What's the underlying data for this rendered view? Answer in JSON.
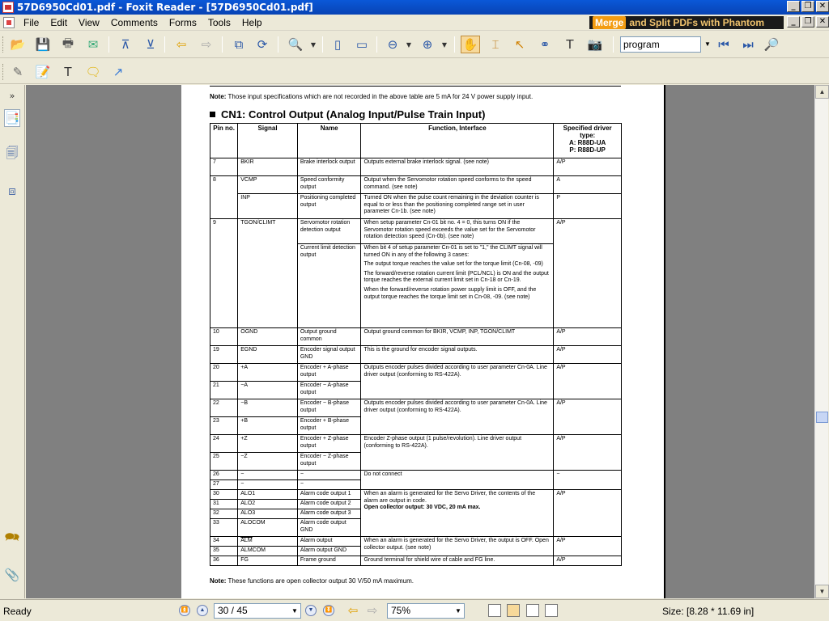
{
  "window": {
    "title": "57D6950Cd01.pdf - Foxit Reader - [57D6950Cd01.pdf]"
  },
  "menu": {
    "items": [
      "File",
      "Edit",
      "View",
      "Comments",
      "Forms",
      "Tools",
      "Help"
    ]
  },
  "promo": {
    "badge": "Merge",
    "text": "and Split PDFs with Phantom"
  },
  "toolbar": {
    "search_value": "program"
  },
  "document": {
    "note_top_label": "Note:",
    "note_top_text": "Those input specifications which are not recorded in the above table are 5 mA for 24 V power supply input.",
    "section_title": "CN1: Control Output (Analog Input/Pulse Train Input)",
    "table": {
      "headers": {
        "pin": "Pin no.",
        "signal": "Signal",
        "name": "Name",
        "function": "Function, Interface",
        "driver_title": "Specified driver type:",
        "driver_a": "A: R88D-UA",
        "driver_p": "P: R88D-UP"
      },
      "rows": [
        {
          "pin": "7",
          "signal": "BKIR",
          "name": "Brake interlock output",
          "function": "Outputs external brake interlock signal. (see note)",
          "driver": "A/P"
        },
        {
          "pin": "8",
          "signal": "VCMP",
          "name": "Speed conformity output",
          "function": "Output when the Servomotor rotation speed conforms to the speed command. (see note)",
          "driver": "A"
        },
        {
          "pin": "",
          "signal": "INP",
          "name": "Positioning completed output",
          "function": "Turned ON when the pulse count remaining in the deviation counter is equal to or less than the positioning completed range set in user parameter Cn-1b. (see note)",
          "driver": "P"
        },
        {
          "pin": "9",
          "signal": "TGON/CLIMT",
          "name": "Servomotor rotation detection output",
          "function": "When setup parameter Cn-01 bit no. 4 = 0, this turns ON if the Servomotor rotation speed exceeds the value set for the Servomotor rotation detection speed (Cn-0b). (see note)",
          "driver": "A/P"
        },
        {
          "pin": "",
          "signal": "",
          "name": "Current limit detection output",
          "function": "When bit 4 of setup parameter Cn-01 is set to \"1,\" the CLIMT signal will turned ON in any of the following 3 cases:",
          "function_2": "The output torque reaches the value set for the torque limit (Cn-08, -09)",
          "function_3": "The forward/reverse rotation current limit (PCL/NCL) is ON and the output torque reaches the external current limit set in Cn-18 or Cn-19.",
          "function_4": "When the forward/reverse rotation power supply limit is OFF, and the output torque reaches the torque limit set in Cn-08, -09. (see note)",
          "driver": ""
        },
        {
          "pin": "10",
          "signal": "OGND",
          "name": "Output ground common",
          "function": "Output ground common for BKIR, VCMP, INP, TGON/CLIMT",
          "driver": "A/P"
        },
        {
          "pin": "19",
          "signal": "EGND",
          "name": "Encoder signal output GND",
          "function": "This is the ground for encoder signal outputs.",
          "driver": "A/P"
        },
        {
          "pin": "20",
          "signal": "+A",
          "name": "Encoder + A-phase output",
          "function": "Outputs encoder pulses divided according to user parameter Cn-0A. Line driver output (conforming to RS-422A).",
          "driver": "A/P"
        },
        {
          "pin": "21",
          "signal": "−A",
          "name": "Encoder − A-phase output",
          "function": "",
          "driver": ""
        },
        {
          "pin": "22",
          "signal": "−B",
          "name": "Encoder − B-phase output",
          "function": "Outputs encoder pulses divided according to user parameter Cn-0A. Line driver output (conforming to RS-422A).",
          "driver": "A/P"
        },
        {
          "pin": "23",
          "signal": "+B",
          "name": "Encoder + B-phase output",
          "function": "",
          "driver": ""
        },
        {
          "pin": "24",
          "signal": "+Z",
          "name": "Encoder + Z-phase output",
          "function": "Encoder Z-phase output (1 pulse/revolution). Line driver output (conforming to RS-422A).",
          "driver": "A/P"
        },
        {
          "pin": "25",
          "signal": "−Z",
          "name": "Encoder − Z-phase output",
          "function": "",
          "driver": ""
        },
        {
          "pin": "26",
          "signal": "−",
          "name": "−",
          "function": "Do not connect",
          "driver": "−"
        },
        {
          "pin": "27",
          "signal": "−",
          "name": "−",
          "function": "",
          "driver": ""
        },
        {
          "pin": "30",
          "signal": "ALO1",
          "name": "Alarm code output 1",
          "function": "When an alarm is generated for the Servo Driver, the contents of the alarm are output in code.",
          "function_bold": "Open collector output: 30 VDC, 20 mA max.",
          "driver": "A/P"
        },
        {
          "pin": "31",
          "signal": "ALO2",
          "name": "Alarm code output 2",
          "function": "",
          "driver": ""
        },
        {
          "pin": "32",
          "signal": "ALO3",
          "name": "Alarm code output 3",
          "function": "",
          "driver": ""
        },
        {
          "pin": "33",
          "signal": "ALOCOM",
          "name": "Alarm code output GND",
          "function": "",
          "driver": ""
        },
        {
          "pin": "34",
          "signal": "ALM",
          "name": "Alarm output",
          "function": "When an alarm is generated for the Servo Driver, the output is OFF. Open collector output. (see note)",
          "driver": "A/P"
        },
        {
          "pin": "35",
          "signal": "ALMCOM",
          "name": "Alarm output GND",
          "function": "",
          "driver": ""
        },
        {
          "pin": "36",
          "signal": "FG",
          "name": "Frame ground",
          "function": "Ground terminal for shield wire of cable and FG line.",
          "driver": "A/P"
        }
      ]
    },
    "note_bottom_label": "Note:",
    "note_bottom_text": "These functions are open collector output 30 V/50 mA maximum."
  },
  "status": {
    "ready": "Ready",
    "page": "30 / 45",
    "zoom": "75%",
    "size": "Size: [8.28 * 11.69 in]"
  },
  "icons": [
    "save-icon",
    "open-icon",
    "print-icon",
    "email-icon",
    "zoom-in-icon",
    "hand-icon",
    "search-icon"
  ]
}
